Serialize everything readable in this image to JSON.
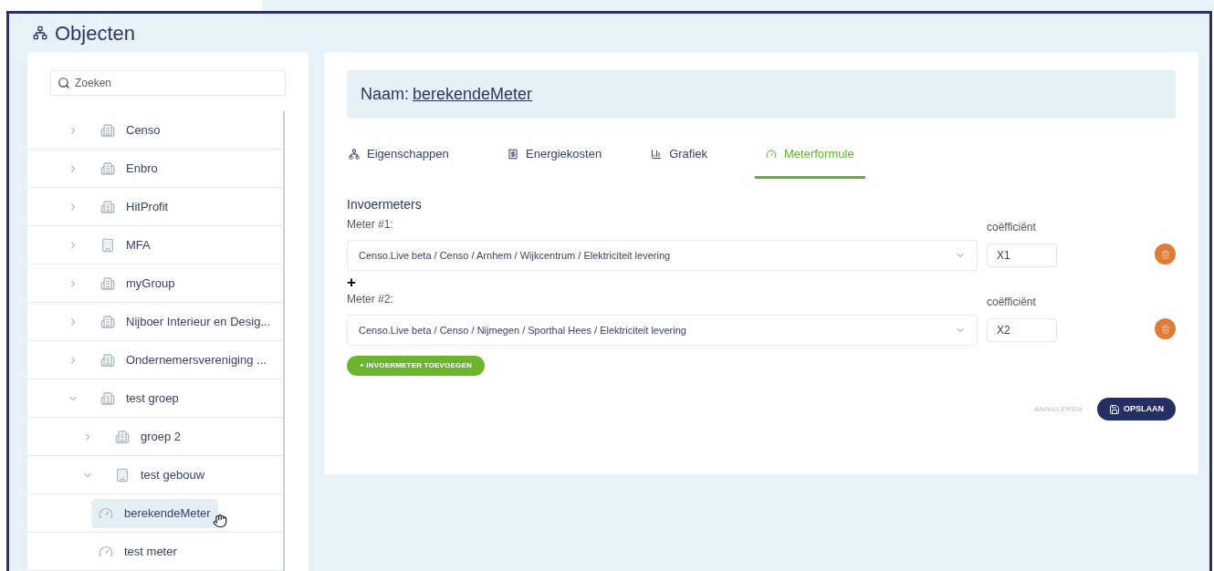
{
  "page": {
    "title": "Objecten"
  },
  "search": {
    "placeholder": "Zoeken"
  },
  "tree": [
    {
      "label": "Censo",
      "kind": "group",
      "expanded": false,
      "selected": false
    },
    {
      "label": "Enbro",
      "kind": "group",
      "expanded": false,
      "selected": false
    },
    {
      "label": "HitProfit",
      "kind": "group",
      "expanded": false,
      "selected": false
    },
    {
      "label": "MFA",
      "kind": "building",
      "expanded": false,
      "selected": false
    },
    {
      "label": "myGroup",
      "kind": "group",
      "expanded": false,
      "selected": false
    },
    {
      "label": "Nijboer Interieur en Desig...",
      "kind": "group",
      "expanded": false,
      "selected": false
    },
    {
      "label": "Ondernemersvereniging ...",
      "kind": "group",
      "expanded": false,
      "selected": false
    },
    {
      "label": "test groep",
      "kind": "group",
      "expanded": true,
      "selected": false,
      "children": [
        {
          "label": "groep 2",
          "kind": "group",
          "expanded": false,
          "selected": false
        },
        {
          "label": "test gebouw",
          "kind": "building",
          "expanded": true,
          "selected": false,
          "children": [
            {
              "label": "berekendeMeter",
              "kind": "meter",
              "selected": true
            },
            {
              "label": "test meter",
              "kind": "meter",
              "selected": false
            }
          ]
        }
      ]
    }
  ],
  "detail": {
    "name_label": "Naam:",
    "name_value": "berekendeMeter"
  },
  "tabs": [
    {
      "label": "Eigenschappen",
      "kind": "properties",
      "selected": false
    },
    {
      "label": "Energiekosten",
      "kind": "costs",
      "selected": false
    },
    {
      "label": "Grafiek",
      "kind": "chart",
      "selected": false
    },
    {
      "label": "Meterformule",
      "kind": "formula",
      "selected": true
    }
  ],
  "section_title": "Invoermeters",
  "meters": [
    {
      "label": "Meter #1:",
      "value": "Censo.Live beta / Censo / Arnhem / Wijkcentrum / Elektriciteit levering",
      "coefficient_label": "coëfficiënt",
      "coefficient": "X1"
    },
    {
      "label": "Meter #2:",
      "value": "Censo.Live beta / Censo / Nijmegen / Sporthal Hees / Elektriciteit levering",
      "coefficient_label": "coëfficiënt",
      "coefficient": "X2"
    }
  ],
  "operator": "+",
  "add_button": "+ INVOERMETER TOEVOEGEN",
  "cancel_button": "ANNULEREN",
  "save_button": "OPSLAAN"
}
